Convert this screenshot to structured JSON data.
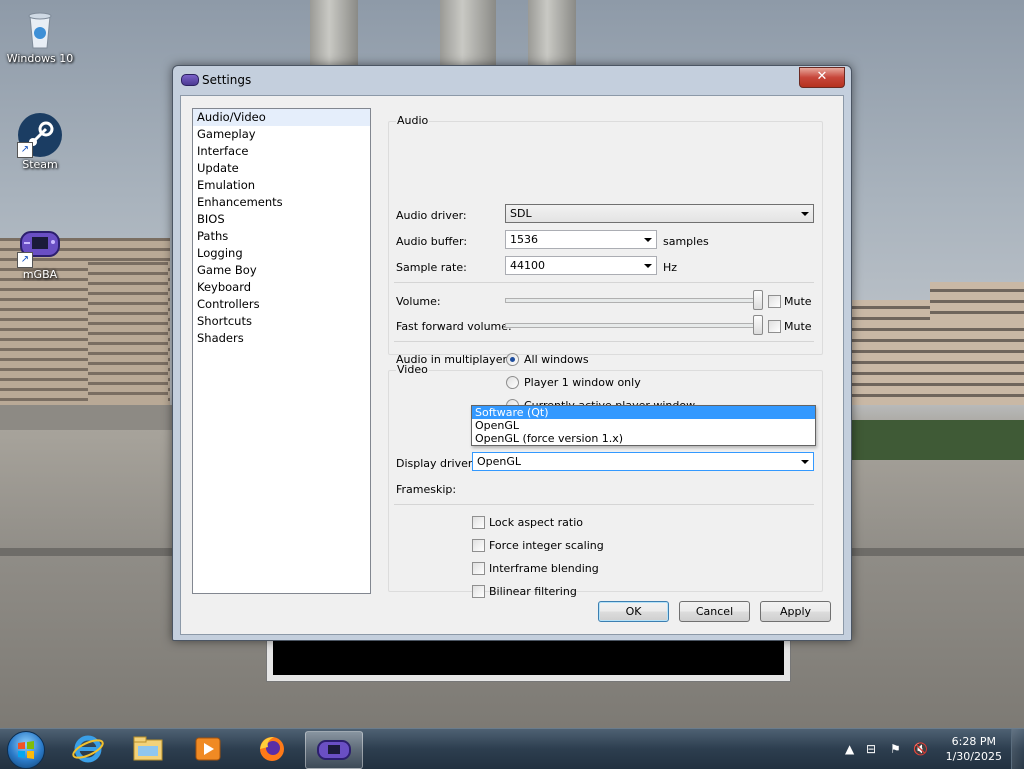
{
  "desktop": {
    "icons": [
      {
        "label": "Windows 10",
        "icon": "recycle-bin-icon"
      },
      {
        "label": "Steam",
        "icon": "steam-icon"
      },
      {
        "label": "mGBA",
        "icon": "mgba-icon"
      }
    ]
  },
  "window": {
    "title": "Settings",
    "close_glyph": "✕"
  },
  "nav": {
    "items": [
      {
        "label": "Audio/Video",
        "selected": true
      },
      {
        "label": "Gameplay"
      },
      {
        "label": "Interface"
      },
      {
        "label": "Update"
      },
      {
        "label": "Emulation"
      },
      {
        "label": "Enhancements"
      },
      {
        "label": "BIOS"
      },
      {
        "label": "Paths"
      },
      {
        "label": "Logging"
      },
      {
        "label": "Game Boy"
      },
      {
        "label": "Keyboard"
      },
      {
        "label": "Controllers"
      },
      {
        "label": "Shortcuts"
      },
      {
        "label": "Shaders"
      }
    ]
  },
  "audio": {
    "group_title": "Audio",
    "driver_label": "Audio driver:",
    "driver_value": "SDL",
    "buffer_label": "Audio buffer:",
    "buffer_value": "1536",
    "buffer_unit": "samples",
    "rate_label": "Sample rate:",
    "rate_value": "44100",
    "rate_unit": "Hz",
    "volume_label": "Volume:",
    "volume_level": 1.0,
    "volume_mute_label": "Mute",
    "ff_volume_label": "Fast forward volume:",
    "ff_volume_level": 1.0,
    "ff_mute_label": "Mute",
    "multiplayer_label": "Audio in multiplayer:",
    "multiplayer_options": [
      {
        "label": "All windows",
        "selected": true
      },
      {
        "label": "Player 1 window only"
      },
      {
        "label": "Currently active player window"
      }
    ]
  },
  "video": {
    "group_title": "Video",
    "display_driver_label": "Display driver:",
    "display_driver_value": "OpenGL",
    "display_driver_options": [
      "Software (Qt)",
      "OpenGL",
      "OpenGL (force version 1.x)"
    ],
    "highlighted_option": "Software (Qt)",
    "frameskip_label": "Frameskip:",
    "checkboxes": [
      {
        "label": "Lock aspect ratio",
        "checked": false
      },
      {
        "label": "Force integer scaling",
        "checked": false
      },
      {
        "label": "Interframe blending",
        "checked": false
      },
      {
        "label": "Bilinear filtering",
        "checked": false
      }
    ]
  },
  "buttons": {
    "ok": "OK",
    "cancel": "Cancel",
    "apply": "Apply"
  },
  "taskbar": {
    "pinned": [
      "internet-explorer-icon",
      "file-explorer-icon",
      "media-player-icon",
      "firefox-icon",
      "mgba-icon"
    ],
    "active": "mgba-icon",
    "clock_time": "6:28 PM",
    "clock_date": "1/30/2025",
    "tray": [
      "show-hidden-icon",
      "network-icon",
      "action-center-flag-icon",
      "volume-muted-icon"
    ]
  }
}
